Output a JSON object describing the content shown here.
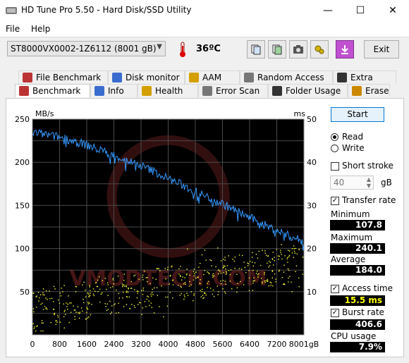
{
  "window": {
    "title": "HD Tune Pro 5.50 - Hard Disk/SSD Utility",
    "minimize": "—",
    "maximize": "☐",
    "close": "✕"
  },
  "menu": {
    "file": "File",
    "help": "Help"
  },
  "toolbar": {
    "drive": "ST8000VX0002-1Z6112 (8001 gB)",
    "temperature": "36ºC",
    "exit": "Exit"
  },
  "tabs_top": [
    {
      "label": "File Benchmark",
      "icon": "file-benchmark-icon"
    },
    {
      "label": "Disk monitor",
      "icon": "disk-monitor-icon"
    },
    {
      "label": "AAM",
      "icon": "speaker-icon"
    },
    {
      "label": "Random Access",
      "icon": "random-access-icon"
    },
    {
      "label": "Extra tests",
      "icon": "extra-tests-icon"
    }
  ],
  "tabs_bottom": [
    {
      "label": "Benchmark",
      "icon": "benchmark-icon"
    },
    {
      "label": "Info",
      "icon": "info-icon"
    },
    {
      "label": "Health",
      "icon": "health-icon"
    },
    {
      "label": "Error Scan",
      "icon": "error-scan-icon"
    },
    {
      "label": "Folder Usage",
      "icon": "folder-icon"
    },
    {
      "label": "Erase",
      "icon": "erase-icon"
    }
  ],
  "controls": {
    "start": "Start",
    "read": "Read",
    "write": "Write",
    "short_stroke": "Short stroke",
    "short_stroke_value": "40",
    "short_stroke_unit": "gB",
    "transfer_rate": "Transfer rate",
    "minimum_label": "Minimum",
    "minimum_value": "107.8 MB/s",
    "maximum_label": "Maximum",
    "maximum_value": "240.1 MB/s",
    "average_label": "Average",
    "average_value": "184.0 MB/s",
    "access_time_label": "Access time",
    "access_time_value": "15.5 ms",
    "burst_rate_label": "Burst rate",
    "burst_rate_value": "406.6 MB/s",
    "cpu_usage_label": "CPU usage",
    "cpu_usage_value": "7.9%"
  },
  "watermark": "VMODTECH.COM",
  "chart_data": {
    "type": "line",
    "ylabel": "MB/s",
    "ylabel_right": "ms",
    "xunit": "gB",
    "xlim": [
      0,
      8001
    ],
    "ylim": [
      0,
      250
    ],
    "ylim_right": [
      0,
      50
    ],
    "x_ticks": [
      "0",
      "800",
      "1600",
      "2400",
      "3200",
      "4000",
      "4800",
      "5600",
      "6400",
      "7200",
      "8001gB"
    ],
    "y_ticks": [
      "250",
      "200",
      "150",
      "100",
      "50"
    ],
    "y_ticks_right": [
      "50",
      "40",
      "30",
      "20",
      "10"
    ],
    "grid": true,
    "series": [
      {
        "color": "#3399ff",
        "x": [
          0,
          400,
          800,
          1200,
          1600,
          2000,
          2400,
          2800,
          3200,
          3600,
          4000,
          4400,
          4800,
          5200,
          5600,
          6000,
          6400,
          6800,
          7200,
          7600,
          8001
        ],
        "y": [
          235,
          232,
          229,
          225,
          220,
          214,
          208,
          202,
          196,
          189,
          181,
          174,
          166,
          159,
          152,
          144,
          136,
          128,
          121,
          114,
          108
        ]
      }
    ],
    "scatter": {
      "color": "#ffff33",
      "note_axis": "right",
      "access_time_ms_range": [
        1,
        21
      ],
      "average_ms": 15.5
    }
  }
}
